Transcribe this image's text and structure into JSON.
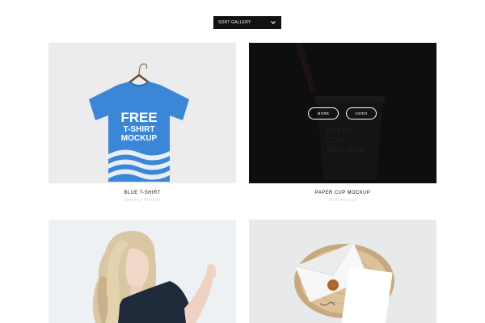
{
  "toolbar": {
    "sort_label": "SORT GALLERY",
    "sort_icon": "chevron-down-icon"
  },
  "gallery": {
    "items": [
      {
        "title": "BLUE T-SHIRT",
        "subtitle": "Branding / Printable",
        "mockup_text": [
          "FREE",
          "T-SHIRT",
          "MOCKUP"
        ]
      },
      {
        "title": "PAPER CUP MOCKUP",
        "subtitle": "Photo Mockups",
        "mockup_text": [
          "PAPER",
          "CUP",
          "MOCKUP"
        ],
        "overlay_buttons": [
          "MORE",
          "VIDEO"
        ]
      },
      {
        "title": "",
        "subtitle": ""
      },
      {
        "title": "",
        "subtitle": ""
      }
    ]
  },
  "colors": {
    "shirt_blue": "#3b86d6",
    "overlay_dark": "#111111",
    "card_bg_light": "#eeeef0"
  }
}
